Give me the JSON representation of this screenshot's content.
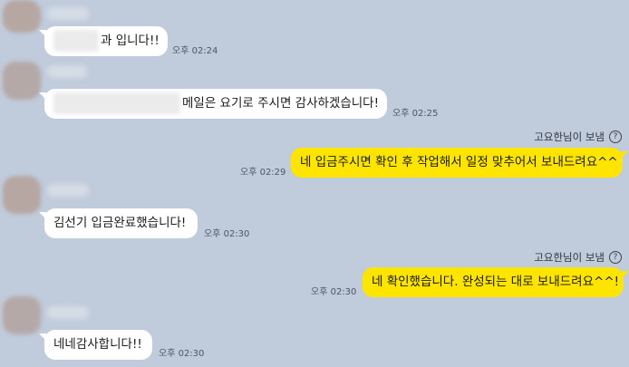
{
  "messages": [
    {
      "id": "m1",
      "side": "in",
      "text": "과 입니다!!",
      "time": "오후 02:24"
    },
    {
      "id": "m2",
      "side": "in",
      "text": "메일은 요기로 주시면 감사하겠습니다!",
      "time": "오후 02:25"
    },
    {
      "id": "m3",
      "side": "out",
      "sender": "고요한님이 보냄",
      "text": "네 입금주시면 확인 후 작업해서 일정 맞추어서 보내드려요^^",
      "time": "오후 02:29"
    },
    {
      "id": "m4",
      "side": "in",
      "text": "김선기 입금완료했습니다!",
      "time": "오후 02:30"
    },
    {
      "id": "m5",
      "side": "out",
      "sender": "고요한님이 보냄",
      "text": "네 확인했습니다. 완성되는 대로 보내드려요^^!",
      "time": "오후 02:30"
    },
    {
      "id": "m6",
      "side": "in",
      "text": "네네감사합니다!!",
      "time": "오후 02:30"
    }
  ],
  "colors": {
    "background": "#c0cbdb",
    "outgoing_bubble": "#fee500",
    "incoming_bubble": "#ffffff"
  },
  "icons": {
    "sender_info": "question-circle-icon"
  }
}
